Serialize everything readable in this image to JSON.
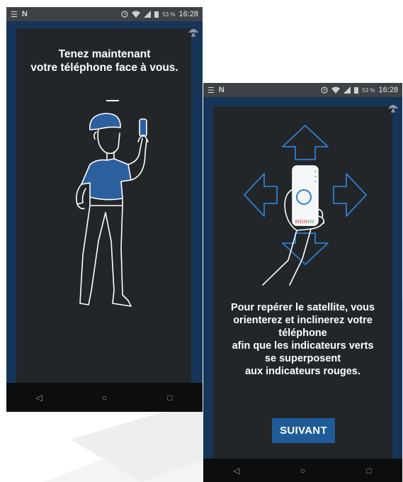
{
  "status_bar": {
    "time": "16:28",
    "battery": "53 %",
    "left_icons": [
      "☰",
      "N"
    ]
  },
  "screen1": {
    "title": "Tenez maintenant\nvotre téléphone face à vous."
  },
  "screen2": {
    "instructions": "Pour repérer le satellite, vous\norienterez et inclinerez votre\ntéléphone\n afin que les indicateurs verts\nse superposent\naux indicateurs rouges.",
    "next_button": "SUIVANT"
  },
  "nav_bar": {
    "back": "◁",
    "home": "○",
    "recents": "□"
  },
  "colors": {
    "accent": "#1f5b97",
    "figure_shirt": "#2c5f9e",
    "panel_background": "#222629",
    "screen_border": "#163558",
    "arrow_outline": "#2f7fd0"
  },
  "icons": [
    "notification-icon",
    "network-icon",
    "alarm-icon",
    "wifi-icon",
    "signal-icon",
    "battery-icon",
    "satellite-icon",
    "back-icon",
    "home-icon",
    "recents-icon",
    "arrow-up-icon",
    "arrow-down-icon",
    "arrow-left-icon",
    "arrow-right-icon"
  ]
}
